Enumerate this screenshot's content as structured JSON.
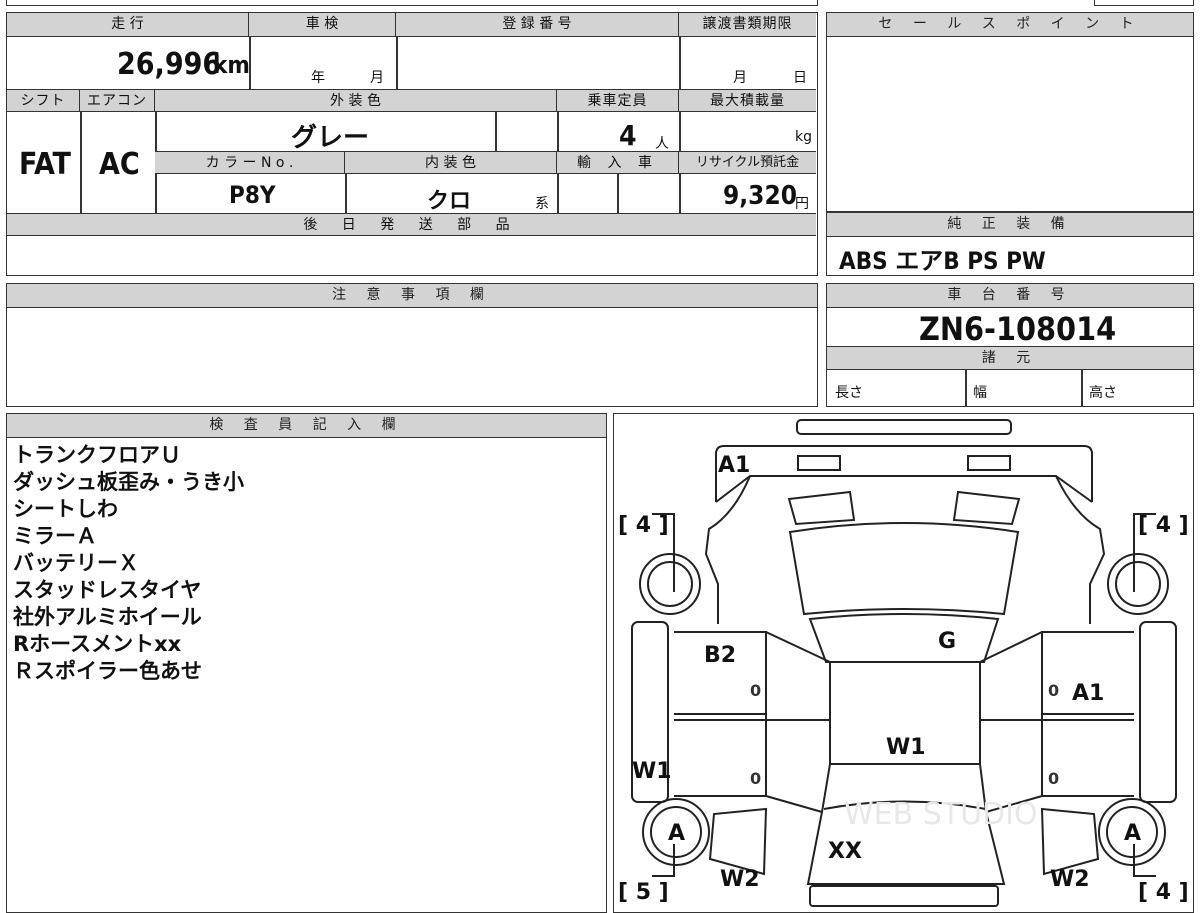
{
  "header_labels": {
    "mileage": "走 行",
    "inspection": "車 検",
    "registration_no": "登 録 番 号",
    "transfer_deadline": "譲渡書類期限",
    "sales_point": "セ ー ル ス ポ イ ン ト",
    "shift": "シフト",
    "aircon": "エアコン",
    "exterior_color": "外 装 色",
    "capacity": "乗車定員",
    "max_load": "最大積載量",
    "color_no": "カ ラ ー N o .",
    "interior_color": "内 装 色",
    "import": "輸 入 車",
    "recycle_fee": "リサイクル預託金",
    "later_parts": "後 日 発 送 部 品",
    "genuine_equipment": "純 正 装 備",
    "notes": "注 意 事 項 欄",
    "chassis_no": "車 台 番 号",
    "specs": "諸 元",
    "inspector_notes": "検 査 員 記 入 欄"
  },
  "vehicle": {
    "mileage": "26,996",
    "mileage_unit": "km",
    "year_unit": "年",
    "month_unit": "月",
    "deadline_month": "月",
    "deadline_day": "日",
    "shift": "FAT",
    "aircon": "AC",
    "exterior_color": "グレー",
    "capacity": "4",
    "capacity_unit": "人",
    "load_unit": "kg",
    "color_no": "P8Y",
    "interior_color": "クロ",
    "interior_suffix": "系",
    "recycle_fee": "9,320",
    "recycle_unit": "円",
    "equipment": "ABS エアB PS PW",
    "chassis_no": "ZN6-108014",
    "length_label": "長さ",
    "width_label": "幅",
    "height_label": "高さ"
  },
  "inspector_notes": [
    "トランクフロアＵ",
    "ダッシュ板歪み・うき小",
    "シートしわ",
    "ミラーＡ",
    "バッテリーＸ",
    "スタッドレスタイヤ",
    "社外アルミホイール",
    "Rホースメントxx",
    "Ｒスポイラー色あせ"
  ],
  "diagram": {
    "marks": [
      "A1",
      "B2",
      "G",
      "A1",
      "W1",
      "W1",
      "XX",
      "W2",
      "W2",
      "A",
      "A"
    ],
    "tread_brackets": [
      "[ 4 ]",
      "[ 4 ]",
      "[ 5 ]",
      "[ 4 ]"
    ],
    "zeros": [
      "0",
      "0",
      "0",
      "0"
    ],
    "watermark": "WEB STUDIO"
  }
}
